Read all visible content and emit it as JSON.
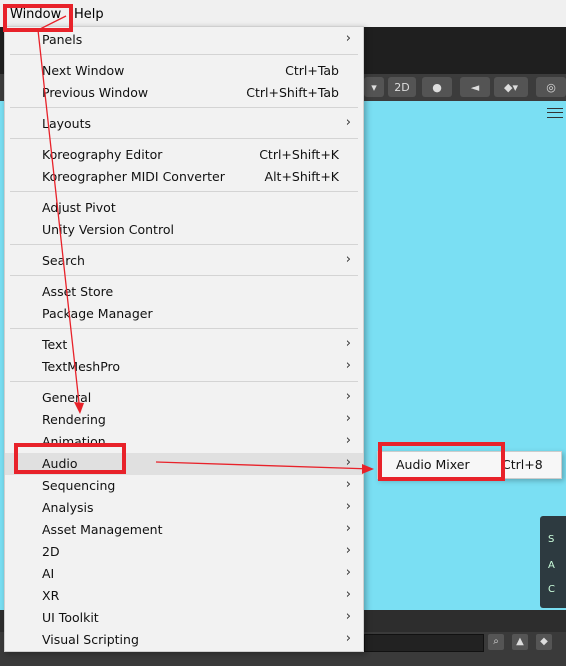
{
  "menubar": {
    "items": [
      "Window",
      "Help"
    ]
  },
  "toolbar": {
    "btn_2d": "2D"
  },
  "menu": {
    "items": [
      {
        "label": "Panels",
        "shortcut": "",
        "submenu": true
      },
      {
        "label": "Next Window",
        "shortcut": "Ctrl+Tab",
        "submenu": false
      },
      {
        "label": "Previous Window",
        "shortcut": "Ctrl+Shift+Tab",
        "submenu": false
      },
      {
        "label": "Layouts",
        "shortcut": "",
        "submenu": true
      },
      {
        "label": "Koreography Editor",
        "shortcut": "Ctrl+Shift+K",
        "submenu": false
      },
      {
        "label": "Koreographer MIDI Converter",
        "shortcut": "Alt+Shift+K",
        "submenu": false
      },
      {
        "label": "Adjust Pivot",
        "shortcut": "",
        "submenu": false
      },
      {
        "label": "Unity Version Control",
        "shortcut": "",
        "submenu": false
      },
      {
        "label": "Search",
        "shortcut": "",
        "submenu": true
      },
      {
        "label": "Asset Store",
        "shortcut": "",
        "submenu": false
      },
      {
        "label": "Package Manager",
        "shortcut": "",
        "submenu": false
      },
      {
        "label": "Text",
        "shortcut": "",
        "submenu": true
      },
      {
        "label": "TextMeshPro",
        "shortcut": "",
        "submenu": true
      },
      {
        "label": "General",
        "shortcut": "",
        "submenu": true
      },
      {
        "label": "Rendering",
        "shortcut": "",
        "submenu": true
      },
      {
        "label": "Animation",
        "shortcut": "",
        "submenu": true
      },
      {
        "label": "Audio",
        "shortcut": "",
        "submenu": true
      },
      {
        "label": "Sequencing",
        "shortcut": "",
        "submenu": true
      },
      {
        "label": "Analysis",
        "shortcut": "",
        "submenu": true
      },
      {
        "label": "Asset Management",
        "shortcut": "",
        "submenu": true
      },
      {
        "label": "2D",
        "shortcut": "",
        "submenu": true
      },
      {
        "label": "AI",
        "shortcut": "",
        "submenu": true
      },
      {
        "label": "XR",
        "shortcut": "",
        "submenu": true
      },
      {
        "label": "UI Toolkit",
        "shortcut": "",
        "submenu": true
      },
      {
        "label": "Visual Scripting",
        "shortcut": "",
        "submenu": true
      }
    ]
  },
  "submenu": {
    "label": "Audio Mixer",
    "shortcut": "Ctrl+8"
  },
  "overlay": {
    "items": [
      "S",
      "A",
      "C"
    ]
  },
  "colors": {
    "annotation": "#e8222a",
    "scene": "#7adff3"
  }
}
